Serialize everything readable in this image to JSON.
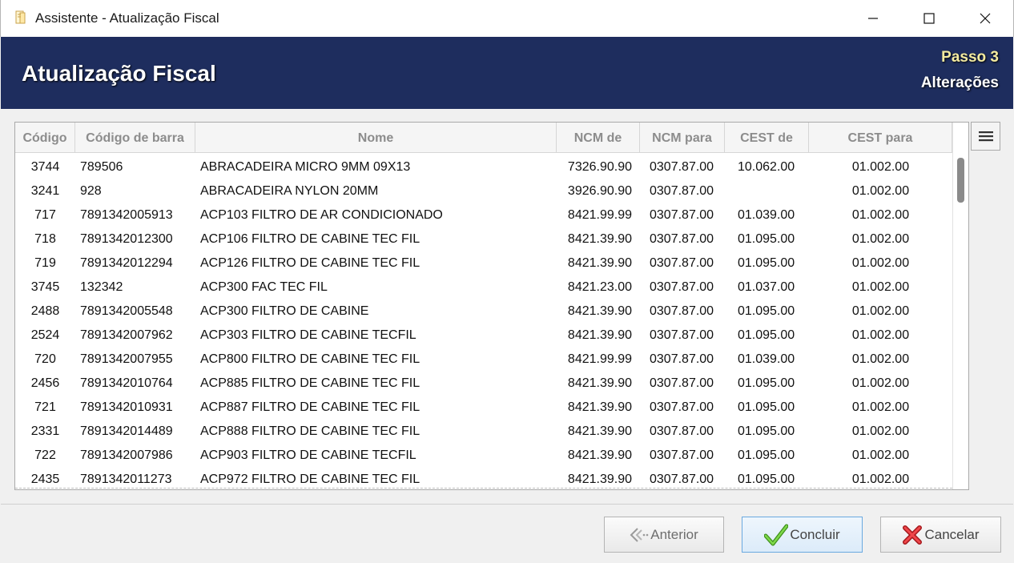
{
  "window": {
    "title": "Assistente - Atualização Fiscal"
  },
  "header": {
    "title": "Atualização Fiscal",
    "step": "Passo 3",
    "subtitle": "Alterações"
  },
  "table": {
    "columns": [
      "Código",
      "Código de barra",
      "Nome",
      "NCM de",
      "NCM para",
      "CEST de",
      "CEST para"
    ],
    "rows": [
      [
        "3744",
        "789506",
        "ABRACADEIRA MICRO 9MM 09X13",
        "7326.90.90",
        "0307.87.00",
        "10.062.00",
        "01.002.00"
      ],
      [
        "3241",
        "928",
        "ABRACADEIRA NYLON 20MM",
        "3926.90.90",
        "0307.87.00",
        "",
        "01.002.00"
      ],
      [
        "717",
        "7891342005913",
        "ACP103 FILTRO DE AR CONDICIONADO",
        "8421.99.99",
        "0307.87.00",
        "01.039.00",
        "01.002.00"
      ],
      [
        "718",
        "7891342012300",
        "ACP106 FILTRO DE CABINE TEC FIL",
        "8421.39.90",
        "0307.87.00",
        "01.095.00",
        "01.002.00"
      ],
      [
        "719",
        "7891342012294",
        "ACP126 FILTRO DE CABINE TEC FIL",
        "8421.39.90",
        "0307.87.00",
        "01.095.00",
        "01.002.00"
      ],
      [
        "3745",
        "132342",
        "ACP300  FAC TEC FIL",
        "8421.23.00",
        "0307.87.00",
        "01.037.00",
        "01.002.00"
      ],
      [
        "2488",
        "7891342005548",
        "ACP300 FILTRO DE CABINE",
        "8421.39.90",
        "0307.87.00",
        "01.095.00",
        "01.002.00"
      ],
      [
        "2524",
        "7891342007962",
        "ACP303 FILTRO DE CABINE TECFIL",
        "8421.39.90",
        "0307.87.00",
        "01.095.00",
        "01.002.00"
      ],
      [
        "720",
        "7891342007955",
        "ACP800 FILTRO DE CABINE TEC FIL",
        "8421.99.99",
        "0307.87.00",
        "01.039.00",
        "01.002.00"
      ],
      [
        "2456",
        "7891342010764",
        "ACP885 FILTRO DE CABINE TEC FIL",
        "8421.39.90",
        "0307.87.00",
        "01.095.00",
        "01.002.00"
      ],
      [
        "721",
        "7891342010931",
        "ACP887 FILTRO DE CABINE TEC FIL",
        "8421.39.90",
        "0307.87.00",
        "01.095.00",
        "01.002.00"
      ],
      [
        "2331",
        "7891342014489",
        "ACP888 FILTRO DE CABINE TEC FIL",
        "8421.39.90",
        "0307.87.00",
        "01.095.00",
        "01.002.00"
      ],
      [
        "722",
        "7891342007986",
        "ACP903 FILTRO DE CABINE TECFIL",
        "8421.39.90",
        "0307.87.00",
        "01.095.00",
        "01.002.00"
      ],
      [
        "2435",
        "7891342011273",
        "ACP972 FILTRO DE CABINE TEC FIL",
        "8421.39.90",
        "0307.87.00",
        "01.095.00",
        "01.002.00"
      ]
    ]
  },
  "buttons": {
    "prev": "Anterior",
    "ok": "Concluir",
    "cancel": "Cancelar"
  },
  "colors": {
    "header_bg": "#1e2d5e",
    "step_text": "#f4eba0",
    "ok_icon": "#5cbf2a",
    "cancel_icon": "#e0262b"
  }
}
